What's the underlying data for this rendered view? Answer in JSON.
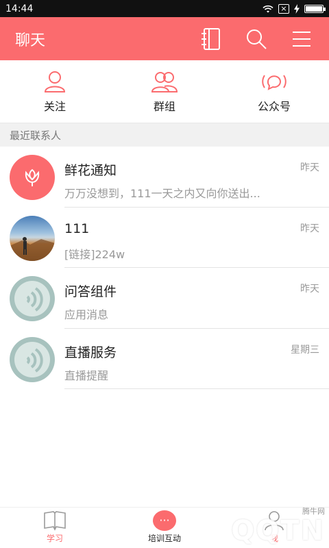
{
  "statusbar": {
    "time": "14:44",
    "x_badge": "×"
  },
  "appbar": {
    "title": "聊天"
  },
  "top_tabs": [
    {
      "label": "关注"
    },
    {
      "label": "群组"
    },
    {
      "label": "公众号"
    }
  ],
  "section": {
    "title": "最近联系人"
  },
  "contacts": [
    {
      "name": "鲜花通知",
      "message": "万万没想到，111一天之内又向你送出...",
      "time": "昨天"
    },
    {
      "name": "111",
      "message": "[链接]224w",
      "time": "昨天"
    },
    {
      "name": "问答组件",
      "message": "应用消息",
      "time": "昨天"
    },
    {
      "name": "直播服务",
      "message": "直播提醒",
      "time": "星期三"
    }
  ],
  "bottom_nav": [
    {
      "label": "学习"
    },
    {
      "label": "培训互动",
      "bubble": "···"
    },
    {
      "label": "我"
    }
  ],
  "watermark": {
    "text": "QQTN",
    "site": "腾牛网"
  },
  "colors": {
    "accent": "#fb6b6e",
    "divider": "#e3e3e3",
    "section_bg": "#f1f1f1"
  }
}
